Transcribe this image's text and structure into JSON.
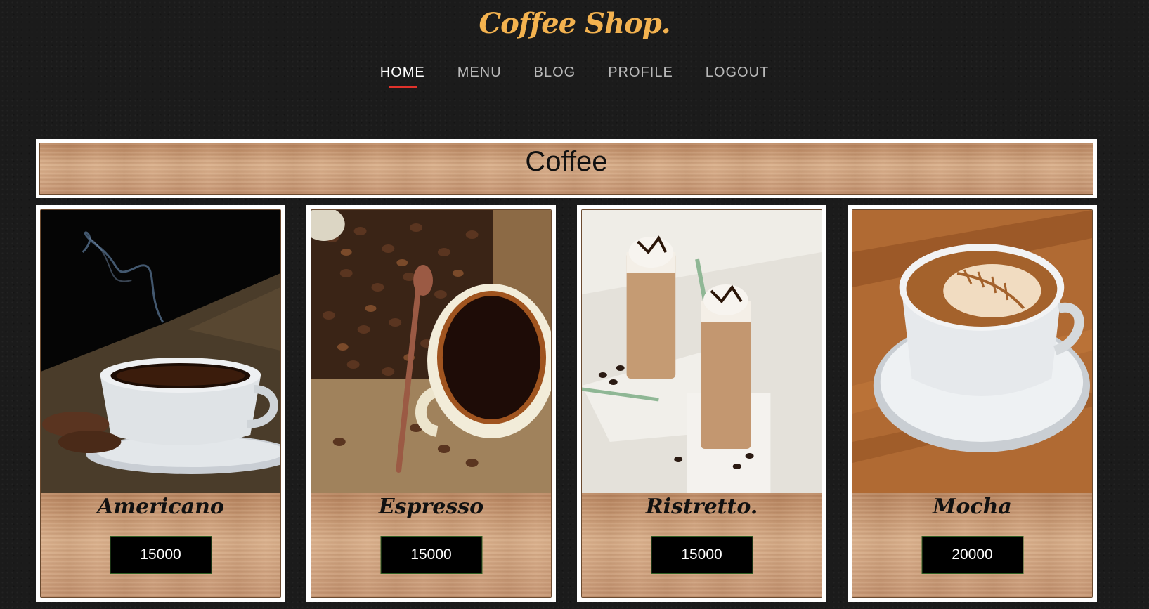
{
  "header": {
    "brand": "Coffee Shop."
  },
  "nav": {
    "items": [
      {
        "label": "HOME",
        "active": true
      },
      {
        "label": "MENU",
        "active": false
      },
      {
        "label": "BLOG",
        "active": false
      },
      {
        "label": "PROFILE",
        "active": false
      },
      {
        "label": "LOGOUT",
        "active": false
      }
    ]
  },
  "section": {
    "title": "Coffee"
  },
  "products": [
    {
      "name": "Americano",
      "price": "15000",
      "image": "coffee-cup-on-burlap-photo"
    },
    {
      "name": "Espresso",
      "price": "15000",
      "image": "espresso-with-beans-photo"
    },
    {
      "name": "Ristretto.",
      "price": "15000",
      "image": "iced-coffee-glasses-photo"
    },
    {
      "name": "Mocha",
      "price": "20000",
      "image": "latte-art-cup-photo"
    }
  ],
  "colors": {
    "brand": "#f3b24f",
    "nav_active_underline": "#e0322b",
    "background": "#1b1b1b"
  }
}
